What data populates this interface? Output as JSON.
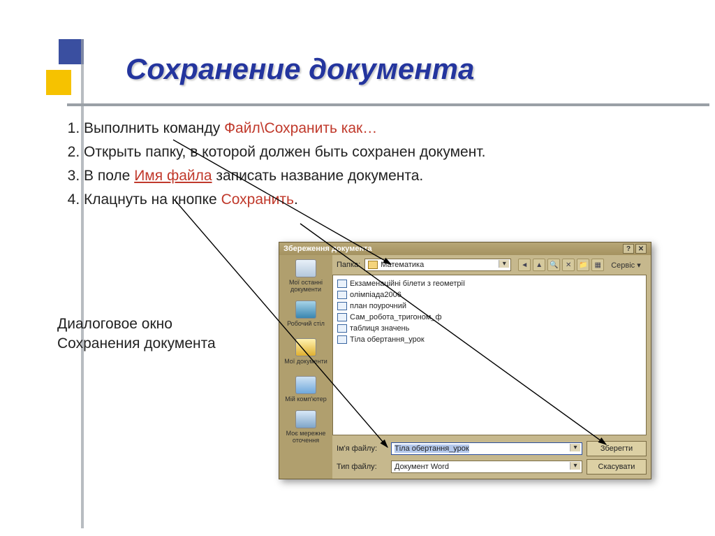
{
  "slide": {
    "title": "Сохранение документа",
    "caption_line1": "Диалоговое окно",
    "caption_line2": "Сохранения документа",
    "steps": {
      "s1_a": "Выполнить команду ",
      "s1_b": "Файл\\Сохранить как…",
      "s2": "Открыть папку, в которой должен быть сохранен документ.",
      "s3_a": "В поле ",
      "s3_b": "Имя файла",
      "s3_c": " записать название документа.",
      "s4_a": "Клацнуть на кнопке ",
      "s4_b": "Сохранить",
      "s4_c": "."
    }
  },
  "dialog": {
    "title": "Збереження документа",
    "help_glyph": "?",
    "close_glyph": "✕",
    "folder_label": "Папка:",
    "folder_value": "Математика",
    "service_label": "Сервіс ▾",
    "sidebar": [
      {
        "label": "Мої останні документи"
      },
      {
        "label": "Робочий стіл"
      },
      {
        "label": "Мої документи"
      },
      {
        "label": "Мій комп'ютер"
      },
      {
        "label": "Моє мережне оточення"
      }
    ],
    "files": [
      "Екзаменаційні білети з геометрії",
      "олімпіада2006",
      "план поурочний",
      "Сам_робота_тригоном_ф",
      "таблиця значень",
      "Тіла обертання_урок"
    ],
    "filename_label": "Ім'я файлу:",
    "filename_value": "Тіла обертання_урок",
    "filetype_label": "Тип файлу:",
    "filetype_value": "Документ Word",
    "save_btn": "Зберегти",
    "cancel_btn": "Скасувати"
  }
}
